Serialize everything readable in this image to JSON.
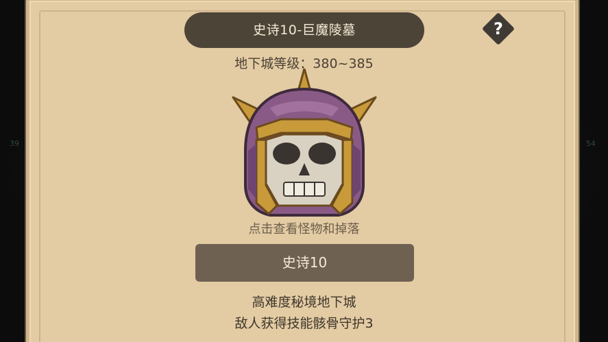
{
  "dungeon": {
    "title": "史诗10-巨魔陵墓",
    "level_text": "地下城等级：380~385",
    "hint": "点击查看怪物和掉落",
    "difficulty_label": "史诗10",
    "description_line1": "高难度秘境地下城",
    "description_line2": "敌人获得技能骸骨守护3"
  },
  "help": {
    "glyph": "?"
  },
  "background": {
    "left_number": "39",
    "right_number": "54"
  },
  "icons": {
    "help": "question-icon",
    "monster": "skull-helmet-icon"
  },
  "colors": {
    "panel": "#e3cba3",
    "banner": "#4d4438",
    "button": "#6f6152",
    "helmet_purple": "#8a5a86",
    "helmet_gold": "#c89a3a"
  }
}
